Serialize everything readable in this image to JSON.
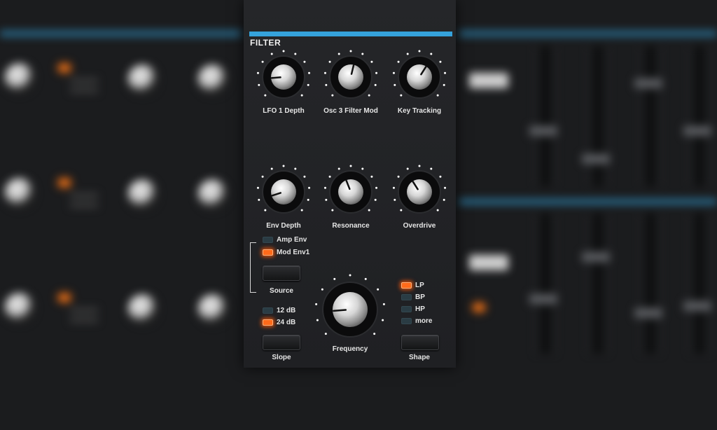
{
  "panel": {
    "title": "FILTER",
    "accent_color": "#35a3dc",
    "knobs": [
      {
        "id": "lfo1-depth",
        "label": "LFO 1 Depth",
        "position": 0.15
      },
      {
        "id": "osc3-filter-mod",
        "label": "Osc 3 Filter Mod",
        "position": 0.55
      },
      {
        "id": "key-tracking",
        "label": "Key Tracking",
        "position": 0.62
      },
      {
        "id": "env-depth",
        "label": "Env Depth",
        "position": 0.1
      },
      {
        "id": "resonance",
        "label": "Resonance",
        "position": 0.42
      },
      {
        "id": "overdrive",
        "label": "Overdrive",
        "position": 0.38
      },
      {
        "id": "frequency",
        "label": "Frequency",
        "position": 0.15
      }
    ],
    "source": {
      "options": [
        {
          "label": "Amp Env",
          "active": false
        },
        {
          "label": "Mod Env1",
          "active": true
        }
      ],
      "button_label": "Source"
    },
    "slope": {
      "options": [
        {
          "label": "12 dB",
          "active": false
        },
        {
          "label": "24 dB",
          "active": true
        }
      ],
      "button_label": "Slope"
    },
    "shape": {
      "options": [
        {
          "label": "LP",
          "active": true
        },
        {
          "label": "BP",
          "active": false
        },
        {
          "label": "HP",
          "active": false
        },
        {
          "label": "more",
          "active": false
        }
      ],
      "button_label": "Shape"
    },
    "led_on_color": "#ff6a1a"
  }
}
